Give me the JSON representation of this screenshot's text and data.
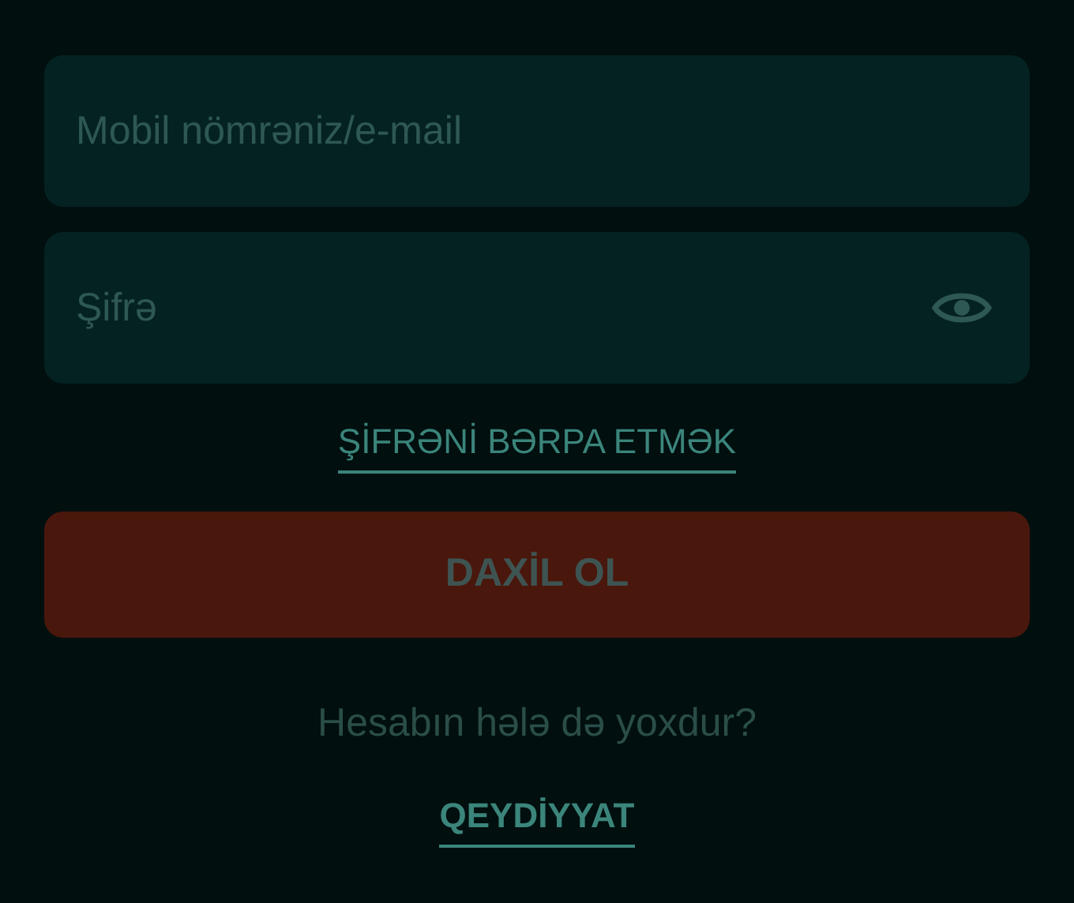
{
  "login_field": {
    "placeholder": "Mobil nömrəniz/e-mail"
  },
  "password_field": {
    "placeholder": "Şifrə",
    "password_visible": false
  },
  "forgot_password_link": "ŞİFRƏNİ BƏRPA ETMƏK",
  "login_button": {
    "label": "DAXİL OL",
    "disabled": true
  },
  "no_account_text": "Hesabın hələ də yoxdur?",
  "register_link": "QEYDİYYAT"
}
